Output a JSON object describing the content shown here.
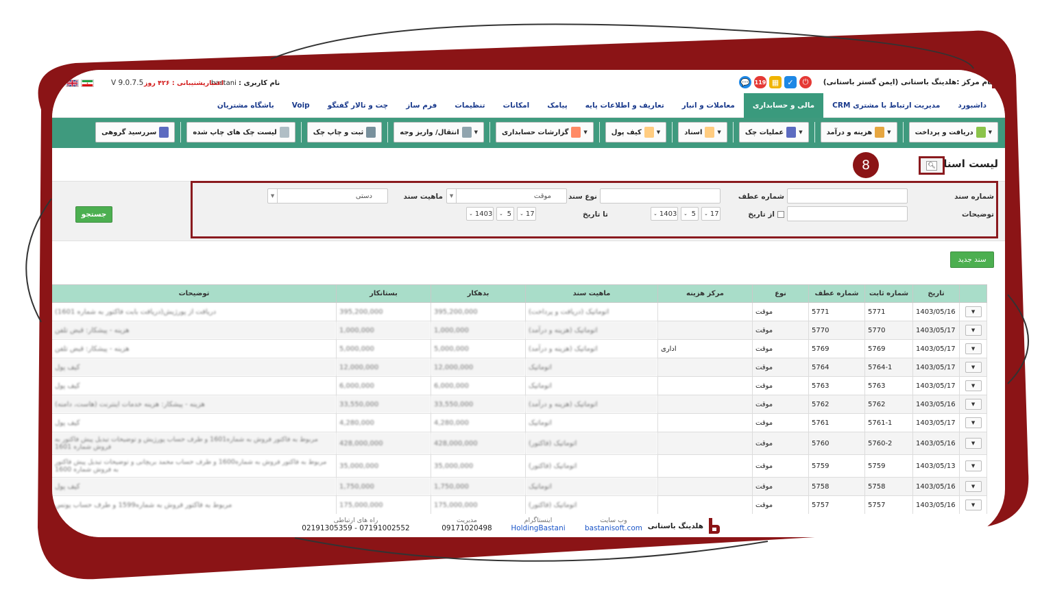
{
  "header": {
    "company_label": "نام مرکز :هلدینگ باستانی (ایمن گستر باستانی)",
    "notification_count": "119",
    "username_label": "نام کاربری :",
    "username": "bastani",
    "support_label": "اعتبارپشتیبانی :",
    "support_days": "۴۲۶ روز",
    "version": "V 9.0.7.5"
  },
  "menu": {
    "items": [
      {
        "label": "داشبورد"
      },
      {
        "label": "مدیریت ارتباط با مشتری CRM"
      },
      {
        "label": "مالی و حسابداری"
      },
      {
        "label": "معاملات و انبار"
      },
      {
        "label": "تعاریف و اطلاعات پایه"
      },
      {
        "label": "پیامک"
      },
      {
        "label": "امکانات"
      },
      {
        "label": "تنظیمات"
      },
      {
        "label": "فرم ساز"
      },
      {
        "label": "چت و تالار گفتگو"
      },
      {
        "label": "Voip"
      },
      {
        "label": "باشگاه مشتریان"
      }
    ],
    "active_index": 2
  },
  "toolbar": {
    "items": [
      {
        "label": "دریافت و پرداخت",
        "dropdown": true
      },
      {
        "label": "هزینه و درآمد",
        "dropdown": true
      },
      {
        "label": "عملیات چک",
        "dropdown": true
      },
      {
        "label": "اسناد",
        "dropdown": true
      },
      {
        "label": "کیف پول",
        "dropdown": true
      },
      {
        "label": "گزارشات حسابداری",
        "dropdown": true
      },
      {
        "label": "انتقال/ واریز وجه",
        "dropdown": true
      },
      {
        "label": "ثبت و چاپ چک",
        "dropdown": false
      },
      {
        "label": "لیست چک های چاپ شده",
        "dropdown": false
      },
      {
        "label": "سررسید گروهی",
        "dropdown": false
      }
    ]
  },
  "page": {
    "title": "لیست اسناد",
    "step_badge": "8"
  },
  "filters": {
    "doc_number_label": "شماره سند",
    "ref_number_label": "شماره عطف",
    "doc_type_label": "نوع سند",
    "doc_nature_label": "ماهیت سند",
    "description_label": "توضیحات",
    "from_date_label": "از تاریخ",
    "to_date_label": "تا تاریخ",
    "doc_type_value": "موقت",
    "doc_nature_value": "دستی",
    "from_date": {
      "day": "17",
      "month": "5",
      "year": "1403"
    },
    "to_date": {
      "day": "17",
      "month": "5",
      "year": "1403"
    },
    "search_button": "جستجو",
    "new_doc_button": "سند جدید"
  },
  "table": {
    "columns": [
      "تاریخ",
      "شماره ثابت",
      "شماره عطف",
      "نوع",
      "مرکز هزینه",
      "ماهیت سند",
      "بدهکار",
      "بستانکار",
      "توضیحات"
    ],
    "rows": [
      {
        "date": "1403/05/16",
        "fixed": "5771",
        "ref": "5771",
        "type": "موقت",
        "center": "",
        "nature": "اتوماتیک (دریافت و پرداخت)",
        "debit": "395,200,000",
        "credit": "395,200,000",
        "desc": "دریافت از پورژیش(دریافت بابت فاکتور به شماره 1601)"
      },
      {
        "date": "1403/05/17",
        "fixed": "5770",
        "ref": "5770",
        "type": "موقت",
        "center": "",
        "nature": "اتوماتیک (هزینه و درآمد)",
        "debit": "1,000,000",
        "credit": "1,000,000",
        "desc": "هزینه - پیشکار: قبض تلفن"
      },
      {
        "date": "1403/05/17",
        "fixed": "5769",
        "ref": "5769",
        "type": "موقت",
        "center": "اداری",
        "nature": "اتوماتیک (هزینه و درآمد)",
        "debit": "5,000,000",
        "credit": "5,000,000",
        "desc": "هزینه - پیشکار: قبض تلفن"
      },
      {
        "date": "1403/05/17",
        "fixed": "5764-1",
        "ref": "5764",
        "type": "موقت",
        "center": "",
        "nature": "اتوماتیک",
        "debit": "12,000,000",
        "credit": "12,000,000",
        "desc": "کیف پول"
      },
      {
        "date": "1403/05/17",
        "fixed": "5763",
        "ref": "5763",
        "type": "موقت",
        "center": "",
        "nature": "اتوماتیک",
        "debit": "6,000,000",
        "credit": "6,000,000",
        "desc": "کیف پول"
      },
      {
        "date": "1403/05/16",
        "fixed": "5762",
        "ref": "5762",
        "type": "موقت",
        "center": "",
        "nature": "اتوماتیک (هزینه و درآمد)",
        "debit": "33,550,000",
        "credit": "33,550,000",
        "desc": "هزینه - پیشکار: هزینه خدمات اینترنت (هاست، دامنه)"
      },
      {
        "date": "1403/05/17",
        "fixed": "5761-1",
        "ref": "5761",
        "type": "موقت",
        "center": "",
        "nature": "اتوماتیک",
        "debit": "4,280,000",
        "credit": "4,280,000",
        "desc": "کیف پول"
      },
      {
        "date": "1403/05/16",
        "fixed": "5760-2",
        "ref": "5760",
        "type": "موقت",
        "center": "",
        "nature": "اتوماتیک (فاکتور)",
        "debit": "428,000,000",
        "credit": "428,000,000",
        "desc": "مربوط به فاکتور فروش به شماره1601 و طرف حساب پورژیش و توضیحات تبدیل پیش فاکتور به فروش شماره 1601"
      },
      {
        "date": "1403/05/13",
        "fixed": "5759",
        "ref": "5759",
        "type": "موقت",
        "center": "",
        "nature": "اتوماتیک (فاکتور)",
        "debit": "35,000,000",
        "credit": "35,000,000",
        "desc": "مربوط به فاکتور فروش به شماره1600 و طرف حساب محمد بریچانی و توضیحات تبدیل پیش فاکتور به فروش شماره 1600"
      },
      {
        "date": "1403/05/16",
        "fixed": "5758",
        "ref": "5758",
        "type": "موقت",
        "center": "",
        "nature": "اتوماتیک",
        "debit": "1,750,000",
        "credit": "1,750,000",
        "desc": "کیف پول"
      },
      {
        "date": "1403/05/16",
        "fixed": "5757",
        "ref": "5757",
        "type": "موقت",
        "center": "",
        "nature": "اتوماتیک (فاکتور)",
        "debit": "175,000,000",
        "credit": "175,000,000",
        "desc": "مربوط به فاکتور فروش به شماره1599 و طرف حساب یونس"
      }
    ]
  },
  "footer": {
    "brand": "هلدینگ باستانی",
    "website_title": "وب سایت",
    "website": "bastanisoft.com",
    "instagram_title": "اینستاگرام",
    "instagram": "HoldingBastani",
    "manager_title": "مدیریت",
    "manager_phone": "09171020498",
    "contact_title": "راه های ارتباطی",
    "contact_phones": "07191002552 - 02191305359"
  },
  "colors": {
    "accent_green": "#3f9a7e",
    "header_green": "#a9ddc9",
    "frame_red": "#8b1416",
    "link_blue": "#1a3a8c"
  }
}
